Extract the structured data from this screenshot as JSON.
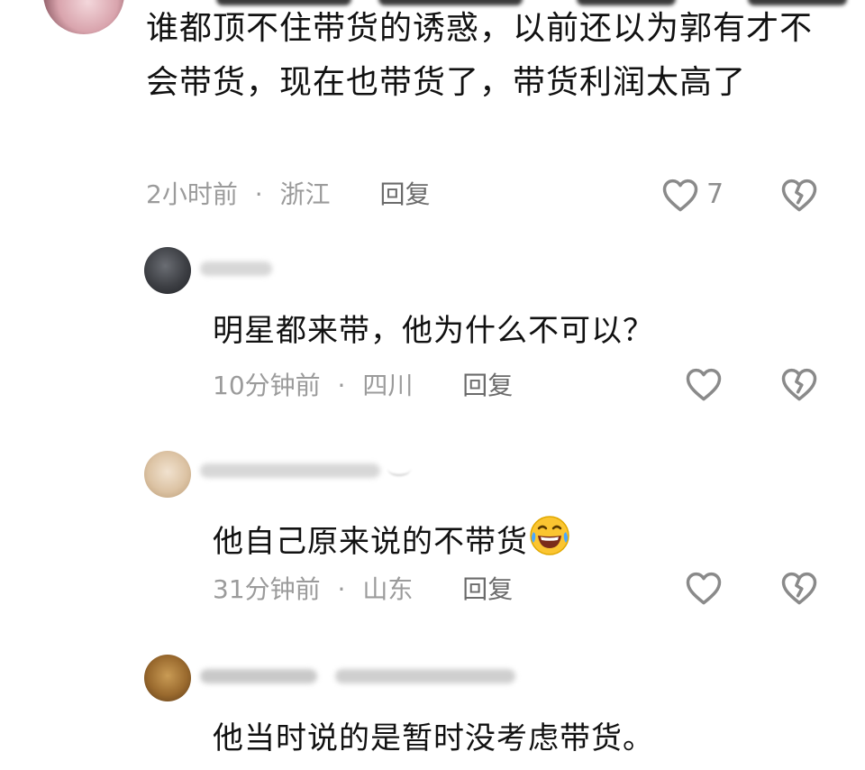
{
  "comments": [
    {
      "text": "谁都顶不住带货的诱惑，以前还以为郭有才不会带货，现在也带货了，带货利润太高了",
      "time": "2小时前",
      "location": "浙江",
      "reply_label": "回复",
      "likes": "7",
      "like_icon": "heart-outline-icon",
      "dislike_icon": "broken-heart-icon"
    }
  ],
  "replies": [
    {
      "text": "明星都来带，他为什么不可以？",
      "time": "10分钟前",
      "location": "四川",
      "reply_label": "回复"
    },
    {
      "text": "他自己原来说的不带货",
      "emoji": "rolling-laughing-emoji",
      "time": "31分钟前",
      "location": "山东",
      "reply_label": "回复"
    },
    {
      "text": "他当时说的是暂时没考虑带货。"
    }
  ],
  "separator": "·",
  "colors": {
    "text": "#111111",
    "meta": "#9b9b9b",
    "icon": "#8a8a8a"
  }
}
